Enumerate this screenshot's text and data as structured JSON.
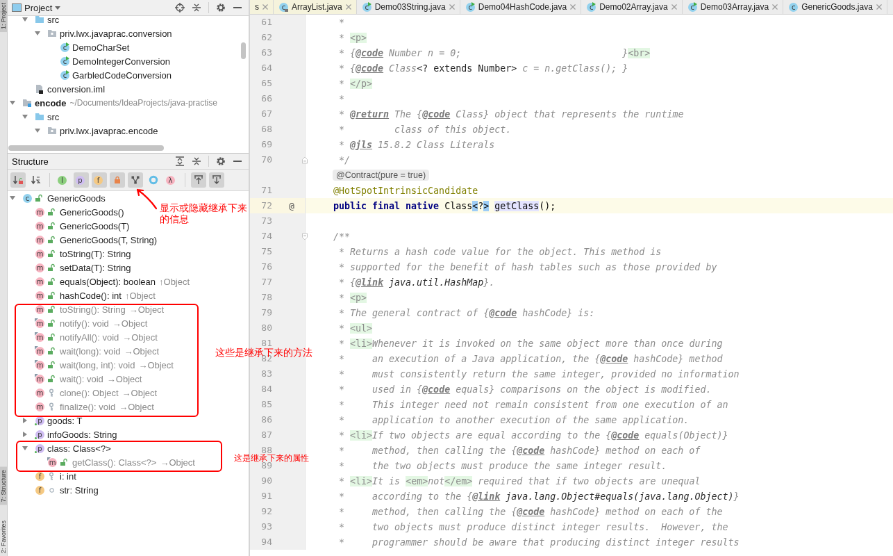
{
  "tool_strip": [
    {
      "label": "1: Project",
      "selected": true
    },
    {
      "label": "7: Structure",
      "selected": true
    },
    {
      "label": "2: Favorites",
      "selected": false
    }
  ],
  "project": {
    "title": "Project",
    "tree": [
      {
        "kind": "clipped",
        "children": [
          {
            "kind": "source-folder",
            "label": "src",
            "expanded": true,
            "children": [
              {
                "kind": "package",
                "label": "priv.lwx.javaprac.conversion",
                "expanded": true,
                "children": [
                  {
                    "kind": "runnable-class",
                    "glyph": "c",
                    "label": "DemoCharSet"
                  },
                  {
                    "kind": "runnable-class",
                    "glyph": "c",
                    "label": "DemoIntegerConversion"
                  },
                  {
                    "kind": "runnable-class",
                    "glyph": "c",
                    "label": "GarbledCodeConversion"
                  }
                ]
              }
            ]
          },
          {
            "kind": "module-file",
            "label": "conversion.iml"
          }
        ]
      },
      {
        "kind": "module",
        "label": "encode",
        "path": "~/Documents/IdeaProjects/java-practise",
        "expanded": true,
        "children": [
          {
            "kind": "source-folder",
            "label": "src",
            "expanded": true,
            "children": [
              {
                "kind": "package",
                "label": "priv.lwx.javaprac.encode",
                "expanded": true
              }
            ]
          }
        ]
      }
    ]
  },
  "structure": {
    "title": "Structure",
    "toolbar": [
      [
        {
          "kind": "sort-by-visibility",
          "selected": true
        },
        {
          "kind": "sort-alphabetically",
          "selected": false
        }
      ],
      [
        {
          "kind": "show-interfaces",
          "glyph": "I",
          "selected": false
        },
        {
          "kind": "show-properties",
          "glyph": "p",
          "selected": true
        },
        {
          "kind": "show-fields",
          "glyph": "f",
          "selected": true
        },
        {
          "kind": "show-non-public",
          "selected": true
        },
        {
          "kind": "show-inherited",
          "selected": true
        },
        {
          "kind": "show-anonymous",
          "selected": false
        },
        {
          "kind": "show-lambdas",
          "glyph": "λ",
          "selected": false
        }
      ],
      [
        {
          "kind": "autoscroll-to-source",
          "selected": true
        },
        {
          "kind": "autoscroll-from-source",
          "selected": true
        }
      ]
    ],
    "tree": [
      {
        "kind": "class",
        "glyph": "c",
        "access": {
          "kind": "public"
        },
        "label": "GenericGoods",
        "greyed": false,
        "final": false,
        "expanded": true,
        "children": [
          {
            "kind": "method",
            "glyph": "m",
            "access": {
              "kind": "public"
            },
            "label": "GenericGoods()",
            "greyed": false,
            "final": false
          },
          {
            "kind": "method",
            "glyph": "m",
            "access": {
              "kind": "public"
            },
            "label": "GenericGoods(T)",
            "greyed": false,
            "final": false
          },
          {
            "kind": "method",
            "glyph": "m",
            "access": {
              "kind": "public"
            },
            "label": "GenericGoods(T, String)",
            "greyed": false,
            "final": false
          },
          {
            "kind": "method",
            "glyph": "m",
            "access": {
              "kind": "public"
            },
            "label": "toString(T): String",
            "greyed": false,
            "final": false
          },
          {
            "kind": "method",
            "glyph": "m",
            "access": {
              "kind": "public"
            },
            "label": "setData(T): String",
            "greyed": false,
            "final": false
          },
          {
            "kind": "method",
            "glyph": "m",
            "access": {
              "kind": "public"
            },
            "label": "equals(Object): boolean",
            "origin": "↑Object",
            "greyed": false,
            "final": false
          },
          {
            "kind": "method",
            "glyph": "m",
            "access": {
              "kind": "public"
            },
            "label": "hashCode(): int",
            "origin": "↑Object",
            "greyed": false,
            "final": false
          },
          {
            "kind": "method",
            "glyph": "m",
            "access": {
              "kind": "public"
            },
            "label": "toString(): String",
            "origin": "→Object",
            "greyed": true,
            "final": false
          },
          {
            "kind": "method",
            "glyph": "m",
            "access": {
              "kind": "public"
            },
            "label": "notify(): void",
            "origin": "→Object",
            "greyed": true,
            "final": true
          },
          {
            "kind": "method",
            "glyph": "m",
            "access": {
              "kind": "public"
            },
            "label": "notifyAll(): void",
            "origin": "→Object",
            "greyed": true,
            "final": true
          },
          {
            "kind": "method",
            "glyph": "m",
            "access": {
              "kind": "public"
            },
            "label": "wait(long): void",
            "origin": "→Object",
            "greyed": true,
            "final": true
          },
          {
            "kind": "method",
            "glyph": "m",
            "access": {
              "kind": "public"
            },
            "label": "wait(long, int): void",
            "origin": "→Object",
            "greyed": true,
            "final": true
          },
          {
            "kind": "method",
            "glyph": "m",
            "access": {
              "kind": "public"
            },
            "label": "wait(): void",
            "origin": "→Object",
            "greyed": true,
            "final": true
          },
          {
            "kind": "method",
            "glyph": "m",
            "access": {
              "kind": "protected"
            },
            "label": "clone(): Object",
            "origin": "→Object",
            "greyed": true,
            "final": false
          },
          {
            "kind": "method",
            "glyph": "m",
            "access": {
              "kind": "protected"
            },
            "label": "finalize(): void",
            "origin": "→Object",
            "greyed": true,
            "final": false
          },
          {
            "kind": "property",
            "glyph": "p",
            "label": "goods: T",
            "greyed": false,
            "final": false,
            "expanded": false
          },
          {
            "kind": "property",
            "glyph": "p",
            "label": "infoGoods: String",
            "greyed": false,
            "final": false,
            "expanded": false
          },
          {
            "kind": "property",
            "glyph": "p",
            "label": "class: Class<?>",
            "greyed": false,
            "final": false,
            "expanded": true,
            "children": [
              {
                "kind": "method",
                "glyph": "m",
                "access": {
                  "kind": "public"
                },
                "label": "getClass(): Class<?>",
                "origin": "→Object",
                "greyed": true,
                "final": true
              }
            ]
          },
          {
            "kind": "field",
            "glyph": "f",
            "access": {
              "kind": "protected"
            },
            "label": "i: int",
            "greyed": false,
            "final": false
          },
          {
            "kind": "field",
            "glyph": "f",
            "access": {
              "kind": "package"
            },
            "label": "str: String",
            "greyed": false,
            "final": false
          }
        ]
      }
    ]
  },
  "editor": {
    "tabs": [
      {
        "kind": "library",
        "label": "s"
      },
      {
        "kind": "library",
        "icon": {
          "kind": "library-class",
          "glyph": "c"
        },
        "label": "ArrayList.java"
      },
      {
        "kind": "project",
        "icon": {
          "kind": "runnable-class",
          "glyph": "c"
        },
        "label": "Demo03String.java"
      },
      {
        "kind": "project",
        "icon": {
          "kind": "runnable-class",
          "glyph": "c"
        },
        "label": "Demo04HashCode.java"
      },
      {
        "kind": "project",
        "icon": {
          "kind": "runnable-class",
          "glyph": "c"
        },
        "label": "Demo02Array.java"
      },
      {
        "kind": "project",
        "icon": {
          "kind": "runnable-class",
          "glyph": "c"
        },
        "label": "Demo03Array.java"
      },
      {
        "kind": "project",
        "icon": {
          "kind": "class",
          "glyph": "c"
        },
        "label": "GenericGoods.java"
      }
    ],
    "lines": [
      {
        "number": "61",
        "segments": [
          {
            "kind": "comment",
            "text": "     *"
          }
        ]
      },
      {
        "number": "62",
        "segments": [
          {
            "kind": "comment",
            "text": "     * "
          },
          {
            "kind": "html-tag",
            "text": "<p>"
          }
        ]
      },
      {
        "number": "63",
        "segments": [
          {
            "kind": "comment",
            "text": "     * {"
          },
          {
            "kind": "doc-tag",
            "text": "@code"
          },
          {
            "kind": "comment",
            "text": " Number n = 0;                             }"
          },
          {
            "kind": "html-tag",
            "text": "<br>"
          }
        ]
      },
      {
        "number": "64",
        "segments": [
          {
            "kind": "comment",
            "text": "     * {"
          },
          {
            "kind": "doc-tag",
            "text": "@code"
          },
          {
            "kind": "comment",
            "text": " Class"
          },
          {
            "kind": "code",
            "text": "<? extends Number>"
          },
          {
            "kind": "comment",
            "text": " c = n.getClass(); }"
          }
        ]
      },
      {
        "number": "65",
        "segments": [
          {
            "kind": "comment",
            "text": "     * "
          },
          {
            "kind": "html-tag",
            "text": "</p>"
          }
        ]
      },
      {
        "number": "66",
        "segments": [
          {
            "kind": "comment",
            "text": "     *"
          }
        ]
      },
      {
        "number": "67",
        "segments": [
          {
            "kind": "comment",
            "text": "     * "
          },
          {
            "kind": "doc-tag",
            "text": "@return"
          },
          {
            "kind": "comment",
            "text": " The {"
          },
          {
            "kind": "doc-tag",
            "text": "@code"
          },
          {
            "kind": "comment",
            "text": " Class} object that represents the runtime"
          }
        ]
      },
      {
        "number": "68",
        "segments": [
          {
            "kind": "comment",
            "text": "     *         class of this object."
          }
        ]
      },
      {
        "number": "69",
        "segments": [
          {
            "kind": "comment",
            "text": "     * "
          },
          {
            "kind": "doc-tag",
            "text": "@jls"
          },
          {
            "kind": "comment",
            "text": " 15.8.2 Class Literals"
          }
        ]
      },
      {
        "number": "70",
        "fold": {
          "kind": "end"
        },
        "segments": [
          {
            "kind": "comment",
            "text": "     */"
          }
        ]
      },
      {
        "kind": "inlay",
        "text": "@Contract(pure = true)"
      },
      {
        "number": "71",
        "segments": [
          {
            "kind": "annotation",
            "text": "    @HotSpotIntrinsicCandidate"
          }
        ]
      },
      {
        "number": "72",
        "current": true,
        "gutter_mark": "@",
        "segments": [
          {
            "kind": "keyword",
            "text": "    public final native"
          },
          {
            "kind": "plain",
            "text": " Class"
          },
          {
            "kind": "brace-match",
            "text": "<"
          },
          {
            "kind": "plain",
            "text": "?"
          },
          {
            "kind": "brace-match",
            "text": ">"
          },
          {
            "kind": "usage",
            "text": "getClass",
            "space_before": true
          },
          {
            "kind": "plain",
            "text": "();"
          }
        ]
      },
      {
        "number": "73"
      },
      {
        "number": "74",
        "fold": {
          "kind": "start"
        },
        "segments": [
          {
            "kind": "comment",
            "text": "    /**"
          }
        ]
      },
      {
        "number": "75",
        "segments": [
          {
            "kind": "comment",
            "text": "     * Returns a hash code value for the object. This method is"
          }
        ]
      },
      {
        "number": "76",
        "segments": [
          {
            "kind": "comment",
            "text": "     * supported for the benefit of hash tables such as those provided by"
          }
        ]
      },
      {
        "number": "77",
        "segments": [
          {
            "kind": "comment",
            "text": "     * {"
          },
          {
            "kind": "doc-tag",
            "text": "@link"
          },
          {
            "kind": "code-ref",
            "text": " java.util.HashMap"
          },
          {
            "kind": "comment",
            "text": "}."
          }
        ]
      },
      {
        "number": "78",
        "segments": [
          {
            "kind": "comment",
            "text": "     * "
          },
          {
            "kind": "html-tag",
            "text": "<p>"
          }
        ]
      },
      {
        "number": "79",
        "segments": [
          {
            "kind": "comment",
            "text": "     * The general contract of {"
          },
          {
            "kind": "doc-tag",
            "text": "@code"
          },
          {
            "kind": "comment",
            "text": " hashCode} is:"
          }
        ]
      },
      {
        "number": "80",
        "segments": [
          {
            "kind": "comment",
            "text": "     * "
          },
          {
            "kind": "html-tag",
            "text": "<ul>"
          }
        ]
      },
      {
        "number": "81",
        "segments": [
          {
            "kind": "comment",
            "text": "     * "
          },
          {
            "kind": "html-tag",
            "text": "<li>"
          },
          {
            "kind": "comment",
            "text": "Whenever it is invoked on the same object more than once during"
          }
        ]
      },
      {
        "number": "82",
        "segments": [
          {
            "kind": "comment",
            "text": "     *     an execution of a Java application, the {"
          },
          {
            "kind": "doc-tag",
            "text": "@code"
          },
          {
            "kind": "comment",
            "text": " hashCode} method"
          }
        ]
      },
      {
        "number": "83",
        "segments": [
          {
            "kind": "comment",
            "text": "     *     must consistently return the same integer, provided no information"
          }
        ]
      },
      {
        "number": "84",
        "segments": [
          {
            "kind": "comment",
            "text": "     *     used in {"
          },
          {
            "kind": "doc-tag",
            "text": "@code"
          },
          {
            "kind": "comment",
            "text": " equals} comparisons on the object is modified."
          }
        ]
      },
      {
        "number": "85",
        "segments": [
          {
            "kind": "comment",
            "text": "     *     This integer need not remain consistent from one execution of an"
          }
        ]
      },
      {
        "number": "86",
        "segments": [
          {
            "kind": "comment",
            "text": "     *     application to another execution of the same application."
          }
        ]
      },
      {
        "number": "87",
        "segments": [
          {
            "kind": "comment",
            "text": "     * "
          },
          {
            "kind": "html-tag",
            "text": "<li>"
          },
          {
            "kind": "comment",
            "text": "If two objects are equal according to the {"
          },
          {
            "kind": "doc-tag",
            "text": "@code"
          },
          {
            "kind": "comment",
            "text": " equals(Object)}"
          }
        ]
      },
      {
        "number": "88",
        "segments": [
          {
            "kind": "comment",
            "text": "     *     method, then calling the {"
          },
          {
            "kind": "doc-tag",
            "text": "@code"
          },
          {
            "kind": "comment",
            "text": " hashCode} method on each of"
          }
        ]
      },
      {
        "number": "89",
        "segments": [
          {
            "kind": "comment",
            "text": "     *     the two objects must produce the same integer result."
          }
        ]
      },
      {
        "number": "90",
        "segments": [
          {
            "kind": "comment",
            "text": "     * "
          },
          {
            "kind": "html-tag",
            "text": "<li>"
          },
          {
            "kind": "comment",
            "text": "It is "
          },
          {
            "kind": "html-tag",
            "text": "<em>"
          },
          {
            "kind": "comment",
            "text": "not"
          },
          {
            "kind": "html-tag",
            "text": "</em>"
          },
          {
            "kind": "comment",
            "text": " required that if two objects are unequal"
          }
        ]
      },
      {
        "number": "91",
        "segments": [
          {
            "kind": "comment",
            "text": "     *     according to the {"
          },
          {
            "kind": "doc-tag",
            "text": "@link"
          },
          {
            "kind": "code-ref",
            "text": " java.lang.Object#equals(java.lang.Object)"
          },
          {
            "kind": "comment",
            "text": "}"
          }
        ]
      },
      {
        "number": "92",
        "segments": [
          {
            "kind": "comment",
            "text": "     *     method, then calling the {"
          },
          {
            "kind": "doc-tag",
            "text": "@code"
          },
          {
            "kind": "comment",
            "text": " hashCode} method on each of the"
          }
        ]
      },
      {
        "number": "93",
        "segments": [
          {
            "kind": "comment",
            "text": "     *     two objects must produce distinct integer results.  However, the"
          }
        ]
      },
      {
        "number": "94",
        "segments": [
          {
            "kind": "comment",
            "text": "     *     programmer should be aware that producing distinct integer results"
          }
        ]
      }
    ]
  },
  "annotations": [
    {
      "kind": "arrow-note",
      "text": "显示或隐藏继承下来的信息"
    },
    {
      "kind": "box-note",
      "text": "这些是继承下来的方法"
    },
    {
      "kind": "box-note",
      "text": "这是继承下来的属性"
    }
  ]
}
